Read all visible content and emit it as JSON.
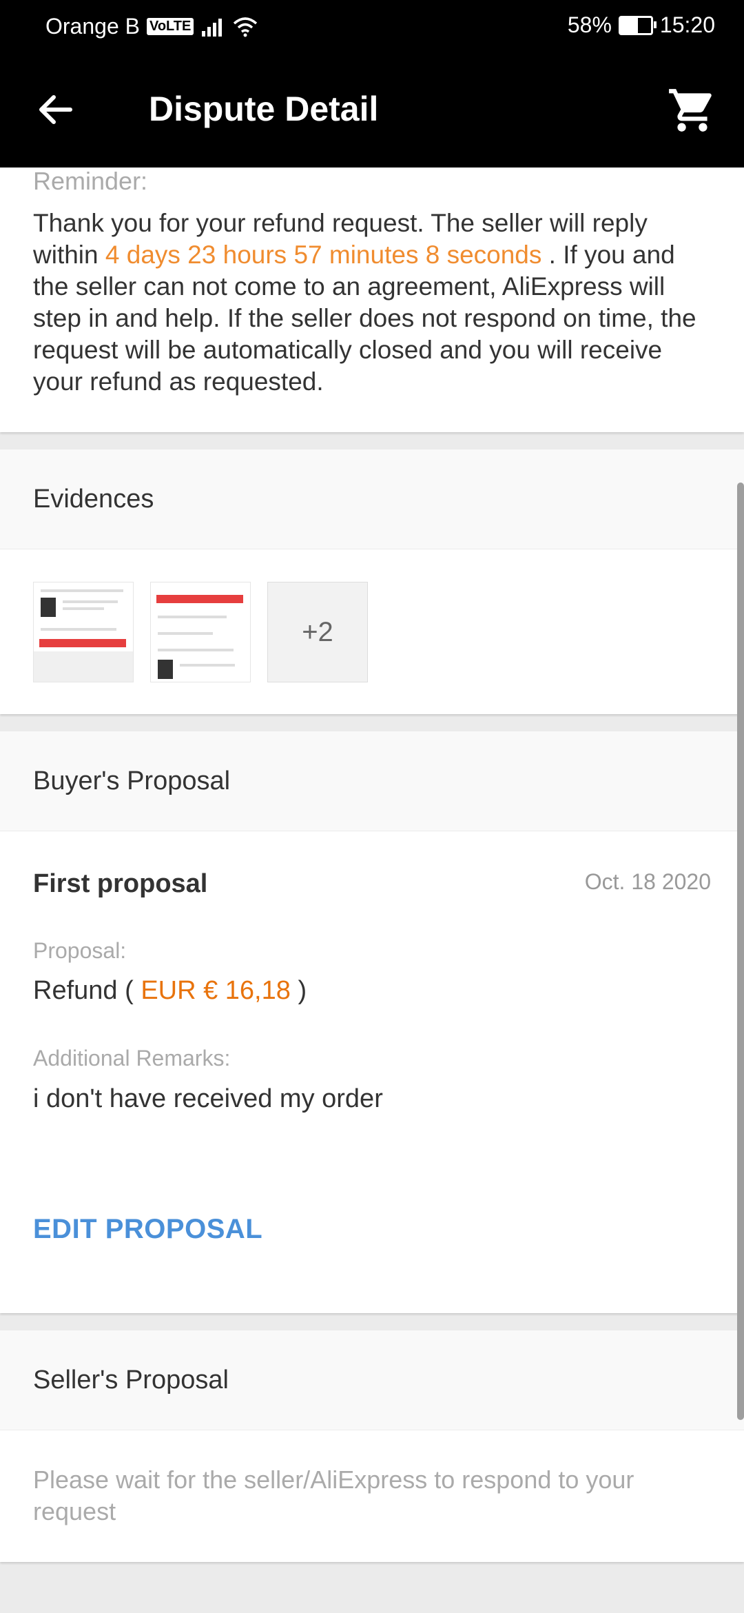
{
  "status_bar": {
    "carrier": "Orange B",
    "volte": "VoLTE",
    "battery": "58%",
    "battery_level": 0.58,
    "time": "15:20"
  },
  "app_bar": {
    "title": "Dispute Detail",
    "back_icon": "back-arrow-icon",
    "cart_icon": "cart-icon"
  },
  "reminder": {
    "label": "Reminder:",
    "text_before": "Thank you for your refund request. The seller will reply within ",
    "countdown": "4 days 23 hours 57 minutes 8 seconds",
    "text_after": " . If you and the seller can not come to an agreement, AliExpress will step in and help. If the seller does not respond on time, the request will be automatically closed and you will receive your refund as requested."
  },
  "evidences": {
    "title": "Evidences",
    "more_count": "+2"
  },
  "buyer_proposal": {
    "title": "Buyer's Proposal",
    "proposal_name": "First proposal",
    "date": "Oct. 18 2020",
    "proposal_label": "Proposal:",
    "refund_prefix": "Refund ( ",
    "refund_amount": "EUR € 16,18",
    "refund_suffix": " )",
    "remarks_label": "Additional Remarks:",
    "remarks": "i don't have received my order",
    "edit_label": "EDIT PROPOSAL"
  },
  "seller_proposal": {
    "title": "Seller's Proposal",
    "wait_text": "Please wait for the seller/AliExpress to respond to your request"
  },
  "colors": {
    "accent_orange": "#f08c2f",
    "link_blue": "#4a90d9",
    "bar_black": "#000000"
  }
}
